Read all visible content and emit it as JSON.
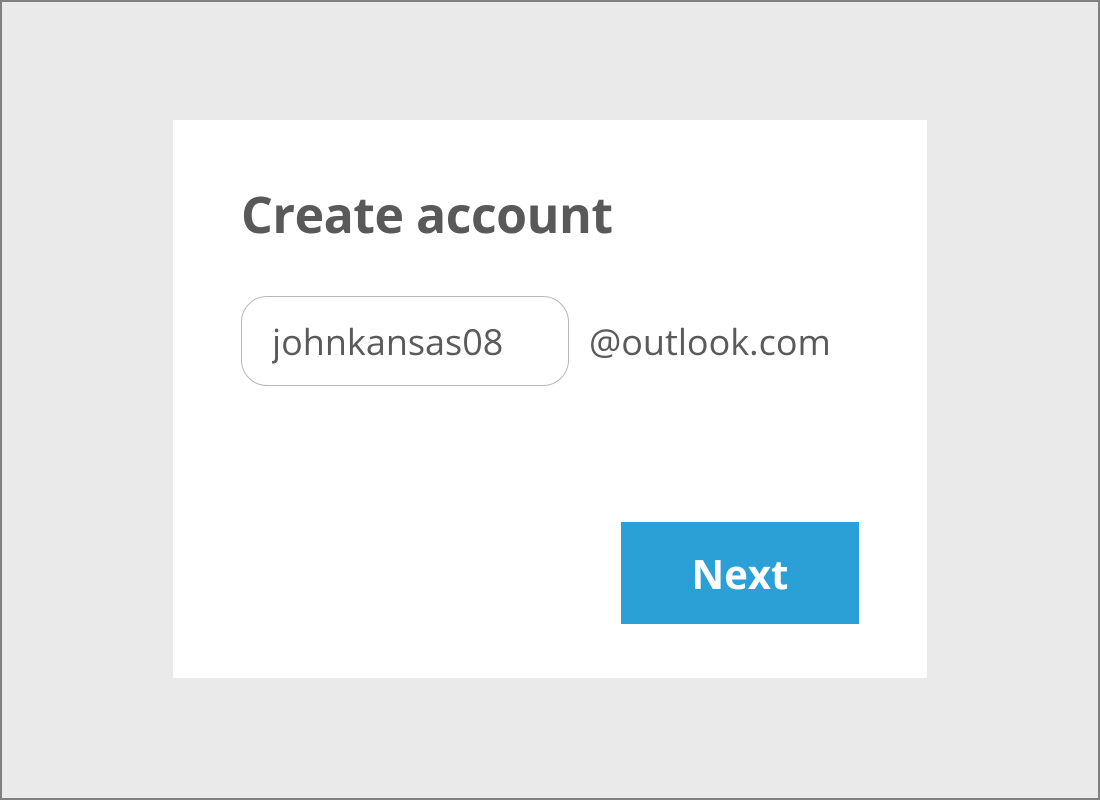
{
  "card": {
    "title": "Create account",
    "username_value": "johnkansas08",
    "domain_suffix": "@outlook.com",
    "next_label": "Next"
  },
  "colors": {
    "accent": "#2ba0d7",
    "page_bg": "#eaeaea",
    "text": "#595959"
  }
}
